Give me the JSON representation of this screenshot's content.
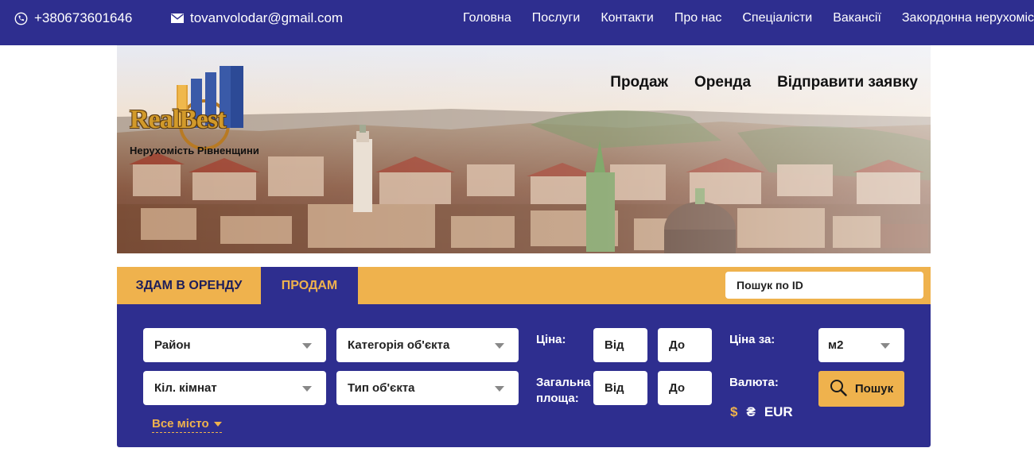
{
  "topbar": {
    "phone": "+380673601646",
    "email": "tovanvolodar@gmail.com",
    "nav": [
      "Головна",
      "Послуги",
      "Контакти",
      "Про нас",
      "Спеціалісти",
      "Вакансії",
      "Закордонна нерухомість"
    ]
  },
  "hero": {
    "logo_text": "RealBest",
    "logo_subtitle": "Нерухомість Рівненщини",
    "nav": [
      "Продаж",
      "Оренда",
      "Відправити заявку"
    ]
  },
  "search": {
    "tab_rent": "ЗДАМ В ОРЕНДУ",
    "tab_sell": "ПРОДАМ",
    "active_tab": "ПРОДАМ",
    "id_placeholder": "Пошук по ID",
    "district": "Район",
    "rooms": "Кіл. кімнат",
    "category": "Категорія об'єкта",
    "object_type": "Тип об'єкта",
    "price_label": "Ціна:",
    "area_label_1": "Загальна",
    "area_label_2": "площа:",
    "from": "Від",
    "to": "До",
    "price_per_label": "Ціна за:",
    "price_per_value": "м2",
    "currency_label": "Валюта:",
    "currencies": [
      "$",
      "₴",
      "EUR"
    ],
    "whole_city": "Все місто",
    "search_button": "Пошук"
  },
  "colors": {
    "navy": "#2e2e8f",
    "accent": "#efb24d",
    "white": "#ffffff"
  },
  "icons": {
    "phone": "phone-icon",
    "email": "envelope-icon",
    "search": "magnifier-icon"
  }
}
